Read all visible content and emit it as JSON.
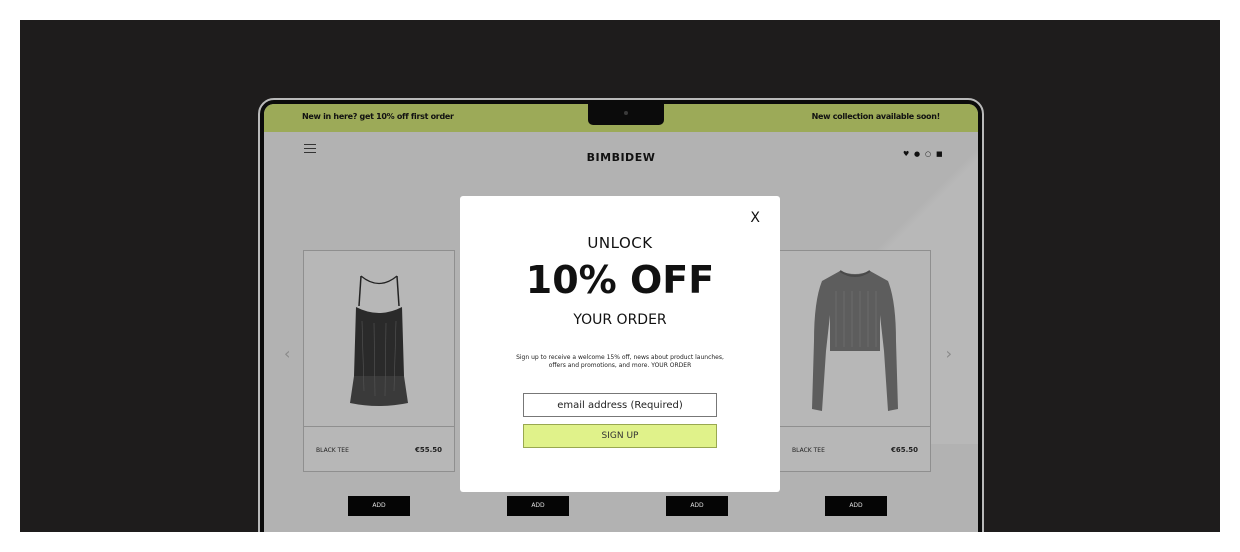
{
  "announcement": {
    "left": "New in here? get 10% off first order",
    "right": "New collection available soon!"
  },
  "header": {
    "brand": "BIMBIDEW"
  },
  "icons": [
    "heart-icon",
    "user-icon",
    "search-icon",
    "bag-icon"
  ],
  "products": [
    {
      "name": "BLACK TEE",
      "price": "€55.50"
    },
    {
      "name": "BLACK TEE",
      "price": "€65.50"
    }
  ],
  "add_buttons": [
    "ADD",
    "ADD",
    "ADD",
    "ADD"
  ],
  "modal": {
    "close": "X",
    "unlock": "UNLOCK",
    "headline": "10% OFF",
    "subline": "YOUR ORDER",
    "description": "Sign up to receive a welcome 15% off, news about product launches, offers and promotions, and more. YOUR ORDER",
    "email_placeholder": "email address (Required)",
    "signup_label": "SIGN UP"
  },
  "colors": {
    "announce_bar": "#9caa58",
    "signup_button": "#e0f28a",
    "background": "#1e1c1c"
  }
}
